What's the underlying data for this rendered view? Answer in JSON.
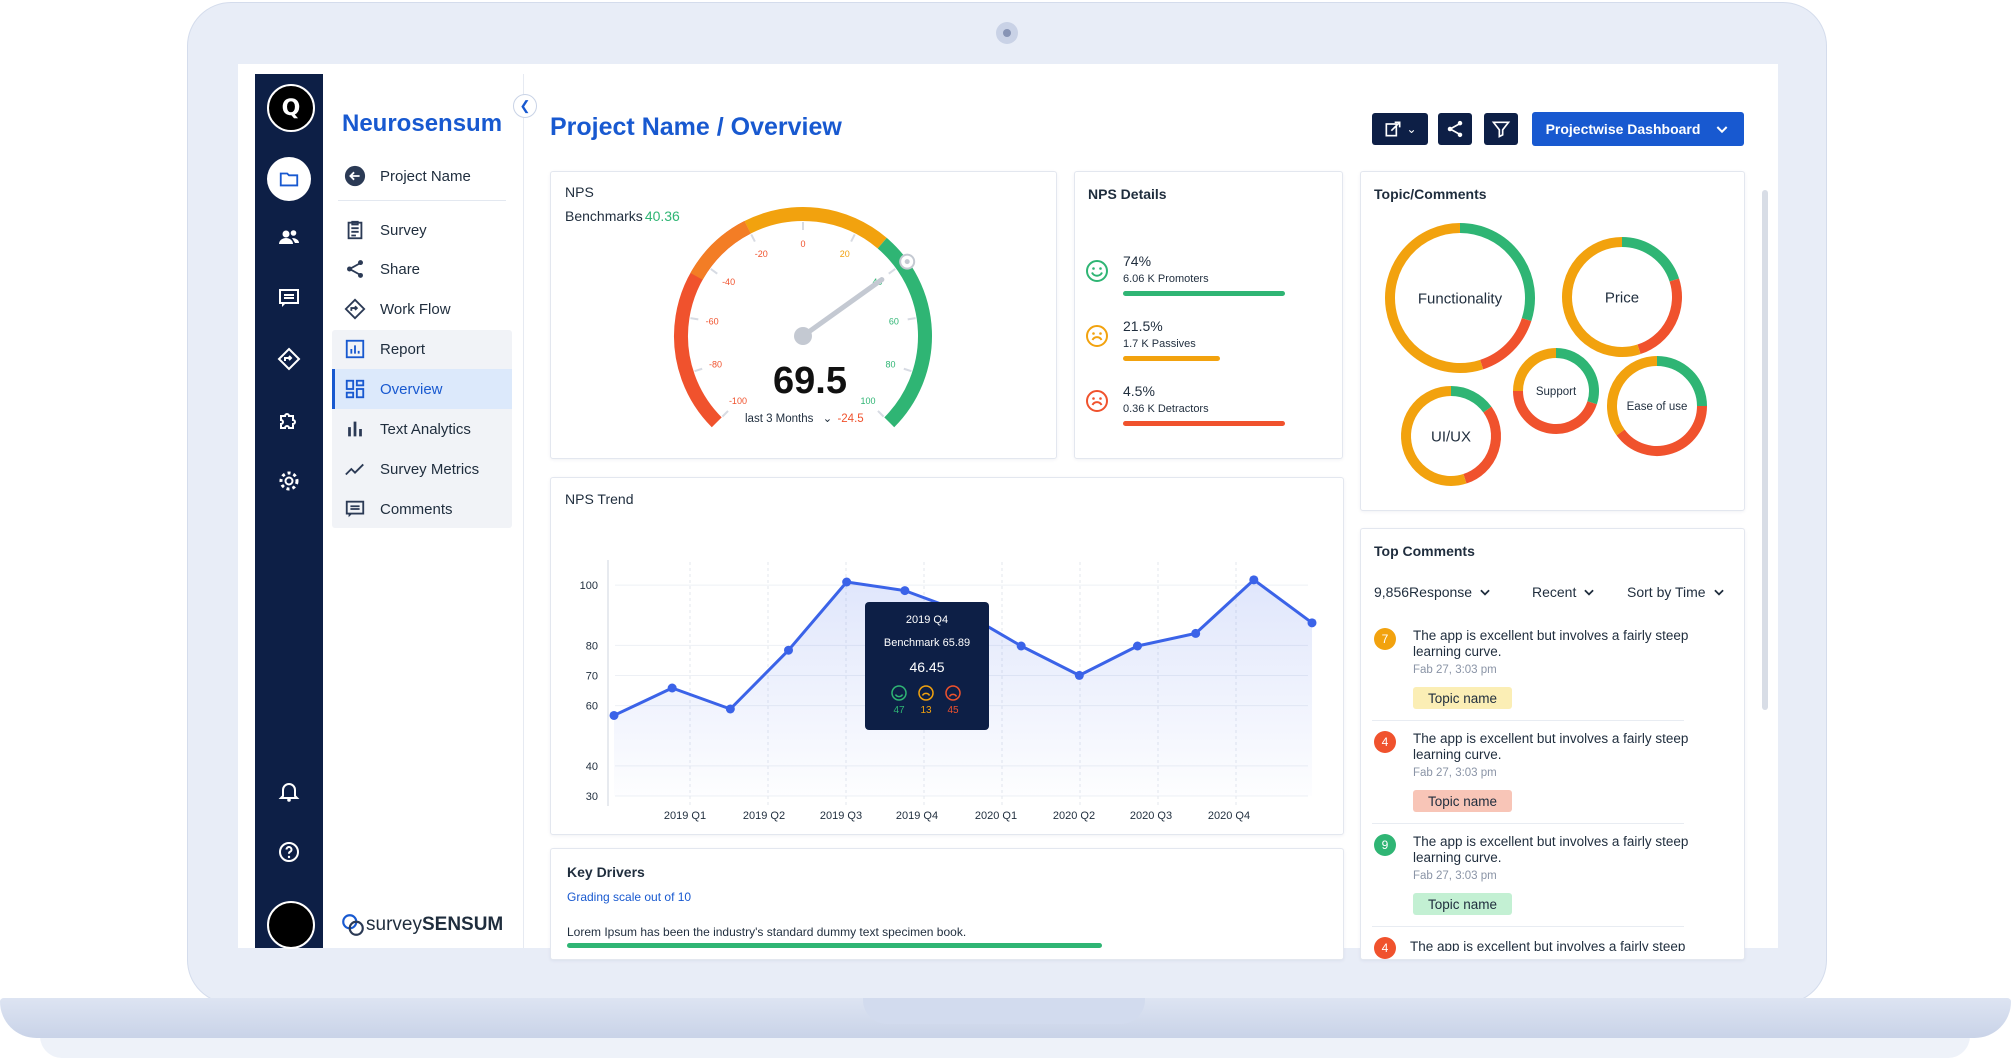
{
  "app": {
    "brand": "Neurosensum",
    "vendor_logo_prefix": "survey",
    "vendor_logo_suffix": "SENSUM"
  },
  "rail": {
    "icons": [
      "folder-icon",
      "users-icon",
      "message-icon",
      "workflow-icon",
      "puzzle-icon",
      "gear-icon",
      "bell-icon",
      "help-icon"
    ]
  },
  "nav": {
    "project": "Project Name",
    "items": [
      {
        "label": "Survey",
        "icon": "clipboard-icon"
      },
      {
        "label": "Share",
        "icon": "share-icon"
      },
      {
        "label": "Work Flow",
        "icon": "workflow-icon"
      },
      {
        "label": "Report",
        "icon": "report-icon"
      },
      {
        "label": "Overview",
        "icon": "dashboard-icon",
        "active": true
      },
      {
        "label": "Text Analytics",
        "icon": "bar-chart-icon"
      },
      {
        "label": "Survey Metrics",
        "icon": "trend-icon"
      },
      {
        "label": "Comments",
        "icon": "comments-icon"
      }
    ]
  },
  "header": {
    "title": "Project Name / Overview",
    "dashboard_select": "Projectwise Dashboard"
  },
  "nps": {
    "title": "NPS",
    "benchmark_label": "Benchmarks",
    "benchmark_value": "40.36",
    "score": "69.5",
    "period": "last 3 Months",
    "change": "-24.5",
    "gauge_ticks": [
      "-100",
      "-80",
      "-60",
      "-40",
      "-20",
      "0",
      "20",
      "40",
      "60",
      "80",
      "100"
    ],
    "score_value": 69.5
  },
  "nps_details": {
    "title": "NPS Details",
    "rows": [
      {
        "pct": "74%",
        "label": "6.06 K Promoters",
        "value": 74,
        "color": "#2fb574"
      },
      {
        "pct": "21.5%",
        "label": "1.7 K Passives",
        "value": 21.5,
        "color": "#f2a20e"
      },
      {
        "pct": "4.5%",
        "label": "0.36 K Detractors",
        "value": 4.5,
        "color": "#f0522d"
      }
    ]
  },
  "topics": {
    "title": "Topic/Comments",
    "items": [
      "Functionality",
      "Price",
      "UI/UX",
      "Support",
      "Ease of use"
    ]
  },
  "trend": {
    "title": "NPS Trend",
    "tooltip": {
      "period": "2019 Q4",
      "benchmark": "Benchmark 65.89",
      "value": "46.45",
      "promoters": "47",
      "passives": "13",
      "detractors": "45"
    }
  },
  "chart_data": {
    "type": "line",
    "title": "NPS Trend",
    "categories": [
      "2019 Q1",
      "2019 Q2",
      "2019 Q3",
      "2019 Q4",
      "2020 Q1",
      "2020 Q2",
      "2020 Q3",
      "2020 Q4"
    ],
    "x": [
      "",
      "2019 Q1",
      "",
      "2019 Q2",
      "",
      "2019 Q3",
      "",
      "2019 Q4",
      "",
      "2020 Q1",
      "",
      "2020 Q2",
      "",
      "2020 Q3",
      "",
      "2020 Q4",
      ""
    ],
    "values": [
      57,
      65,
      60,
      74,
      100,
      96,
      86,
      75,
      68,
      75,
      78,
      101,
      81
    ],
    "yticks": [
      30,
      40,
      60,
      70,
      80,
      100
    ],
    "ylim": [
      30,
      105
    ],
    "grid": true
  },
  "key_drivers": {
    "title": "Key Drivers",
    "subtitle": "Grading scale out of 10",
    "item": "Lorem Ipsum has been the industry's standard dummy text specimen book."
  },
  "top_comments": {
    "title": "Top Comments",
    "response_count": "9,856",
    "response_label": "Response",
    "filter_recent": "Recent",
    "sort": "Sort by Time",
    "items": [
      {
        "num": "7",
        "color": "#f2a20e",
        "text": "The app is excellent but involves a fairly steep learning curve.",
        "date": "Fab 27, 3:03 pm",
        "tag": "Topic name",
        "tag_bg": "#fbeeb5"
      },
      {
        "num": "4",
        "color": "#f0522d",
        "text": "The app is excellent but involves a fairly steep learning curve.",
        "date": "Fab 27, 3:03 pm",
        "tag": "Topic name",
        "tag_bg": "#f8c5b7"
      },
      {
        "num": "9",
        "color": "#2fb574",
        "text": "The app is excellent but involves a fairly steep learning curve.",
        "date": "Fab 27, 3:03 pm",
        "tag": "Topic name",
        "tag_bg": "#c3f0d3"
      },
      {
        "num": "4",
        "color": "#f0522d",
        "text": "The app is excellent but involves a fairly steep",
        "date": "",
        "tag": "",
        "tag_bg": ""
      }
    ]
  },
  "colors": {
    "accent": "#1859d0",
    "navy": "#0d1f46",
    "green": "#2fb574",
    "orange": "#f2a20e",
    "red": "#f0522d"
  }
}
